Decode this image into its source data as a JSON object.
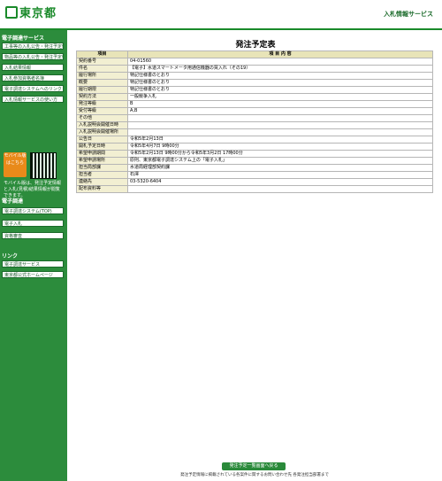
{
  "header": {
    "logo": "東京都",
    "site": "入札情報サービス"
  },
  "sidebar": {
    "section1": "電子調達",
    "items1": [
      "電子調達システム(TOP)",
      "電子入札",
      "資格審査"
    ],
    "section_top": "電子調達サービス",
    "items_top": [
      "工事等の入札公告・発注予定情報",
      "物品等の入札公告・発注予定情報",
      "入札結果情報",
      "入札参加資格者名簿",
      "電子調達システムへのリンク",
      "入札情報サービスの使い方"
    ],
    "mobile_label": "モバイル版はこちら",
    "mobile_note": "モバイル版は、発注予定情報と入札(見積)結果情報が閲覧できます。",
    "links_title": "リンク",
    "links": [
      "電子調達サービス",
      "東京都公式ホームページ"
    ]
  },
  "page_title": "発注予定表",
  "table": {
    "col_item": "項目",
    "col_content": "項 目 内 容",
    "rows": [
      {
        "k": "契約番号",
        "v": "04-01560"
      },
      {
        "k": "件名",
        "v": "【電子】水道スマートメータ用通信機器の買入れ（その19）"
      },
      {
        "k": "履行場所",
        "v": "特記仕様書のとおり"
      },
      {
        "k": "概要",
        "v": "特記仕様書のとおり"
      },
      {
        "k": "履行期限",
        "v": "特記仕様書のとおり"
      },
      {
        "k": "契約方法",
        "v": "一般競争入札"
      },
      {
        "k": "発注等級",
        "v": "B"
      },
      {
        "k": "受付等級",
        "v": "A,B"
      },
      {
        "k": "その他",
        "v": ""
      },
      {
        "k": "入札説明会開催日時",
        "v": ""
      },
      {
        "k": "入札説明会開催場所",
        "v": ""
      },
      {
        "k": "公告日",
        "v": "令和5年2月13日"
      },
      {
        "k": "開札予定日時",
        "v": "令和5年4月7日 9時00分"
      },
      {
        "k": "希望申請期間",
        "v": "令和5年2月13日 9時00分から令和5年3月2日 17時00分"
      },
      {
        "k": "希望申請場所",
        "v": "原則、東京都電子調達システム上の「電子入札」"
      },
      {
        "k": "担当局部課",
        "v": "水道局経理部契約課"
      },
      {
        "k": "担当者",
        "v": "石澤"
      },
      {
        "k": "連絡先",
        "v": "03-5320-6404"
      },
      {
        "k": "配布資料等",
        "v": ""
      }
    ]
  },
  "list_button": "発注予定一覧画面へ戻る",
  "footer": "発注予定情報に掲載されている各案件に関するお問い合わせ先 各発注担当部署まで"
}
